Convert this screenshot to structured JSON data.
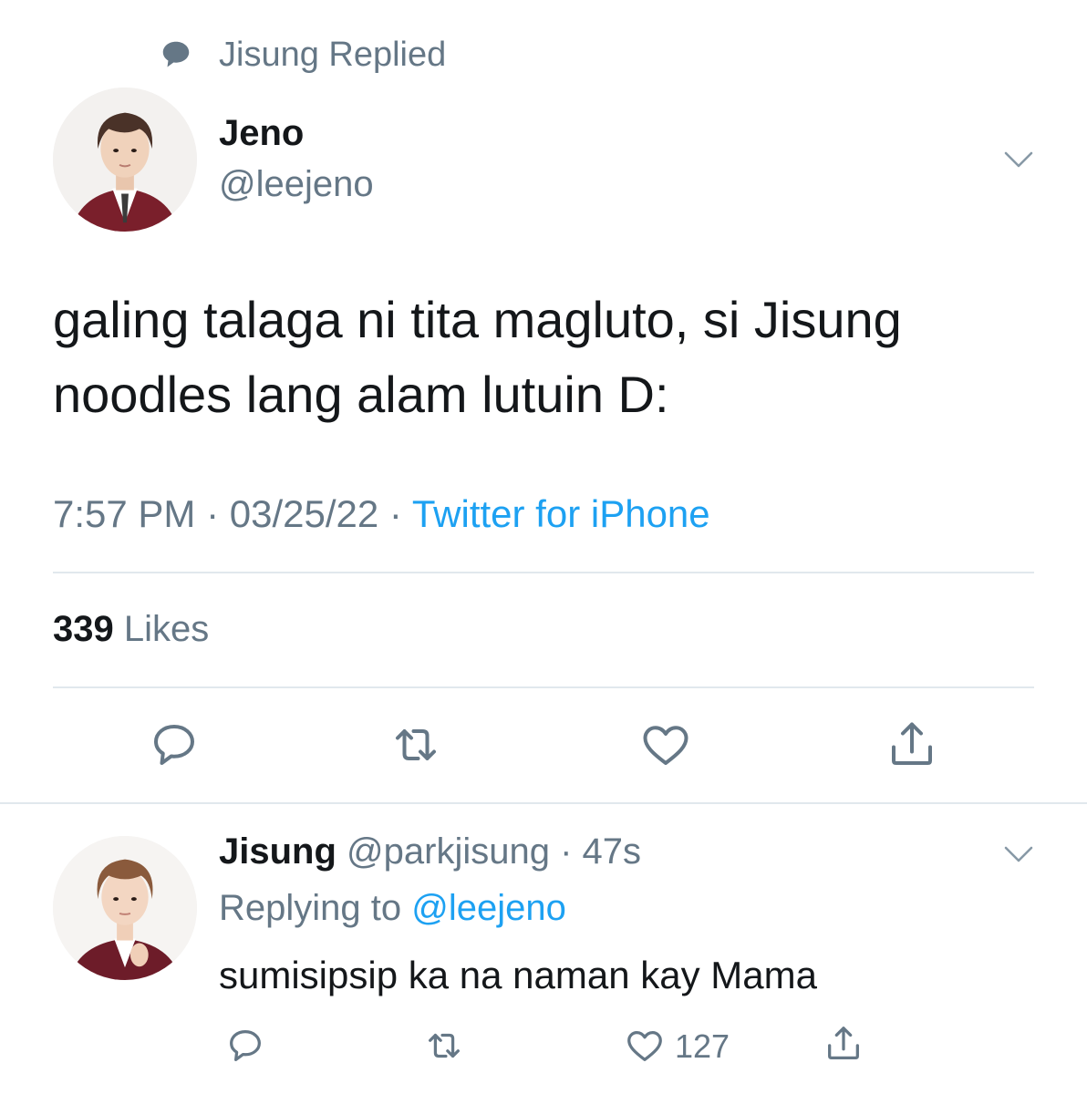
{
  "context": {
    "icon": "speech-bubble-icon",
    "label": "Jisung Replied"
  },
  "tweet": {
    "display_name": "Jeno",
    "handle": "@leejeno",
    "text_line1": "galing talaga ni tita magluto, si Jisung",
    "text_line2": "noodles lang alam lutuin D:",
    "time": "7:57 PM",
    "sep1": " · ",
    "date": "03/25/22",
    "sep2": " · ",
    "source": "Twitter for iPhone",
    "like_count": "339",
    "like_label": " Likes"
  },
  "reply": {
    "display_name": "Jisung",
    "handle": " @parkjisung",
    "time_sep": " · ",
    "time": "47s",
    "replying_prefix": "Replying to ",
    "replying_mention": "@leejeno",
    "text": "sumisipsip ka na naman kay Mama",
    "like_count": "127"
  },
  "colors": {
    "text": "#14171a",
    "secondary": "#657786",
    "link": "#1da1f2",
    "divider": "#e1e8ed",
    "icon": "#657786"
  }
}
